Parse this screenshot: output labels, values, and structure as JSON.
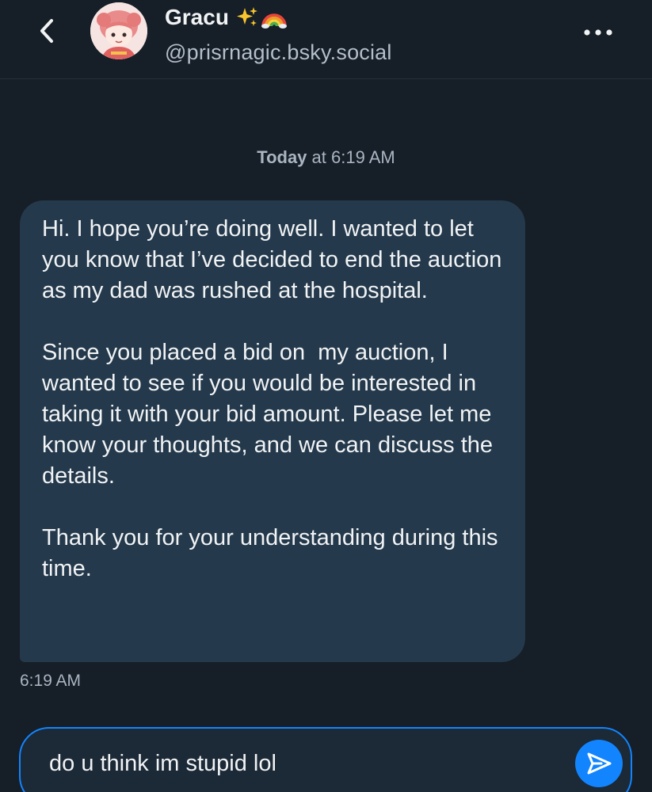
{
  "header": {
    "display_name": "Gracu",
    "emojis": "✨🌈",
    "handle": "@prisrnagic.bsky.social",
    "back_icon": "chevron-left-icon",
    "more_icon": "more-horizontal-icon"
  },
  "conversation": {
    "day_label": "Today",
    "day_time": " at 6:19 AM",
    "messages": [
      {
        "paragraphs": [
          "Hi. I hope you’re doing well. I wanted to let you know that I’ve decided to end the auction as my dad was rushed at the hospital.",
          "Since you placed a bid on  my auction, I wanted to see if you would be interested in taking it with your bid amount. Please let me know your thoughts, and we can discuss the details.",
          "Thank you for your understanding during this time."
        ],
        "time": "6:19 AM"
      }
    ]
  },
  "composer": {
    "value": "do u think im stupid lol",
    "send_icon": "send-icon"
  },
  "colors": {
    "background": "#161e27",
    "bubble": "#24394b",
    "accent": "#1285fe",
    "muted_text": "#a9b5c2"
  }
}
